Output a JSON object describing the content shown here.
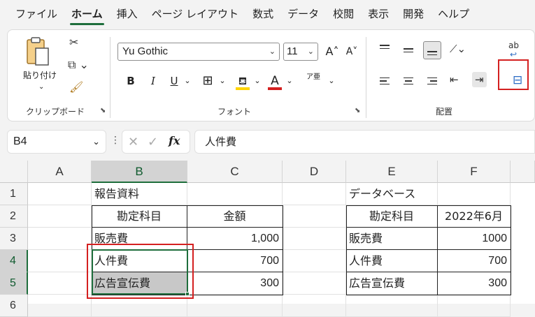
{
  "tabs": [
    "ファイル",
    "ホーム",
    "挿入",
    "ページ レイアウト",
    "数式",
    "データ",
    "校閲",
    "表示",
    "開発",
    "ヘルプ"
  ],
  "active_tab": "ホーム",
  "ribbon": {
    "clipboard": {
      "paste_label": "貼り付け",
      "group_label": "クリップボード"
    },
    "font": {
      "font_name": "Yu Gothic",
      "font_size": "11",
      "group_label": "フォント",
      "bold": "B",
      "italic": "I",
      "underline": "U",
      "grow": "A˄",
      "shrink": "A˅",
      "font_color_letter": "A",
      "phonetic": "ア亜"
    },
    "alignment": {
      "group_label": "配置",
      "wrap_label": "ab"
    }
  },
  "formula_bar": {
    "name_box": "B4",
    "formula": "人件費",
    "fx_label": "fx"
  },
  "sheet": {
    "columns": [
      "A",
      "B",
      "C",
      "D",
      "E",
      "F"
    ],
    "rows": [
      "1",
      "2",
      "3",
      "4",
      "5",
      "6"
    ],
    "cells": {
      "B1": "報告資料",
      "E1": "データベース",
      "B2": "勘定科目",
      "C2": "金額",
      "E2": "勘定科目",
      "F2": "2022年6月",
      "B3": "販売費",
      "C3": "1,000",
      "E3": "販売費",
      "F3": "1000",
      "B4": "人件費",
      "C4": "700",
      "E4": "人件費",
      "F4": "700",
      "B5": "広告宣伝費",
      "C5": "300",
      "E5": "広告宣伝費",
      "F5": "300"
    },
    "selected_cell": "B4",
    "selected_range": "B4:B5"
  },
  "colors": {
    "accent": "#1e6e3c",
    "highlight": "#d42020",
    "font_color_bar": "#d42020",
    "fill_color_bar": "#ffd400"
  }
}
